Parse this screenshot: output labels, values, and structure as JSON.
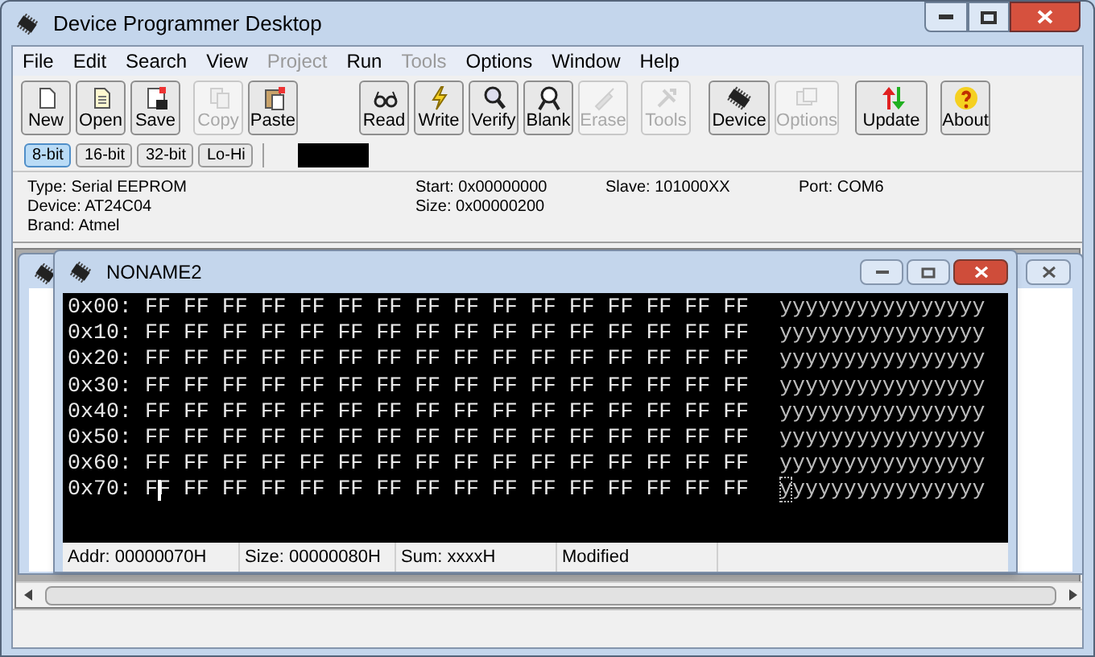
{
  "window": {
    "title": "Device Programmer Desktop"
  },
  "menu": [
    {
      "label": "File",
      "disabled": false
    },
    {
      "label": "Edit",
      "disabled": false
    },
    {
      "label": "Search",
      "disabled": false
    },
    {
      "label": "View",
      "disabled": false
    },
    {
      "label": "Project",
      "disabled": true
    },
    {
      "label": "Run",
      "disabled": false
    },
    {
      "label": "Tools",
      "disabled": true
    },
    {
      "label": "Options",
      "disabled": false
    },
    {
      "label": "Window",
      "disabled": false
    },
    {
      "label": "Help",
      "disabled": false
    }
  ],
  "toolbar_groups": [
    [
      {
        "label": "New",
        "kind": "new",
        "disabled": false
      },
      {
        "label": "Open",
        "kind": "open",
        "disabled": false
      },
      {
        "label": "Save",
        "kind": "save",
        "disabled": false
      }
    ],
    [
      {
        "label": "Copy",
        "kind": "copy",
        "disabled": true
      },
      {
        "label": "Paste",
        "kind": "paste",
        "disabled": false
      }
    ],
    [
      {
        "label": "Read",
        "kind": "read",
        "disabled": false
      },
      {
        "label": "Write",
        "kind": "write",
        "disabled": false
      },
      {
        "label": "Verify",
        "kind": "verify",
        "disabled": false
      },
      {
        "label": "Blank",
        "kind": "blank",
        "disabled": false
      },
      {
        "label": "Erase",
        "kind": "erase",
        "disabled": true
      }
    ],
    [
      {
        "label": "Tools",
        "kind": "tools",
        "disabled": true
      }
    ],
    [
      {
        "label": "Device",
        "kind": "device",
        "disabled": false
      },
      {
        "label": "Options",
        "kind": "options",
        "disabled": true
      }
    ],
    [
      {
        "label": "Update",
        "kind": "update",
        "disabled": false
      }
    ],
    [
      {
        "label": "About",
        "kind": "about",
        "disabled": false
      }
    ]
  ],
  "width_tabs": [
    {
      "label": "8-bit",
      "selected": true
    },
    {
      "label": "16-bit",
      "selected": false
    },
    {
      "label": "32-bit",
      "selected": false
    },
    {
      "label": "Lo-Hi",
      "selected": false
    }
  ],
  "info_columns": [
    [
      "Type: Serial EEPROM",
      "Device: AT24C04",
      "Brand: Atmel"
    ],
    [
      "Start: 0x00000000",
      "Size: 0x00000200"
    ],
    [
      "Slave: 101000XX"
    ],
    [
      "Port: COM6"
    ]
  ],
  "editor": {
    "title": "NONAME2",
    "rows": [
      {
        "address": "0x00:",
        "hex": "FF FF FF FF FF FF FF FF FF FF FF FF FF FF FF FF",
        "ascii": "yyyyyyyyyyyyyyyy",
        "cursor": false
      },
      {
        "address": "0x10:",
        "hex": "FF FF FF FF FF FF FF FF FF FF FF FF FF FF FF FF",
        "ascii": "yyyyyyyyyyyyyyyy",
        "cursor": false
      },
      {
        "address": "0x20:",
        "hex": "FF FF FF FF FF FF FF FF FF FF FF FF FF FF FF FF",
        "ascii": "yyyyyyyyyyyyyyyy",
        "cursor": false
      },
      {
        "address": "0x30:",
        "hex": "FF FF FF FF FF FF FF FF FF FF FF FF FF FF FF FF",
        "ascii": "yyyyyyyyyyyyyyyy",
        "cursor": false
      },
      {
        "address": "0x40:",
        "hex": "FF FF FF FF FF FF FF FF FF FF FF FF FF FF FF FF",
        "ascii": "yyyyyyyyyyyyyyyy",
        "cursor": false
      },
      {
        "address": "0x50:",
        "hex": "FF FF FF FF FF FF FF FF FF FF FF FF FF FF FF FF",
        "ascii": "yyyyyyyyyyyyyyyy",
        "cursor": false
      },
      {
        "address": "0x60:",
        "hex": "FF FF FF FF FF FF FF FF FF FF FF FF FF FF FF FF",
        "ascii": "yyyyyyyyyyyyyyyy",
        "cursor": false
      },
      {
        "address": "0x70:",
        "hex": "FF FF FF FF FF FF FF FF FF FF FF FF FF FF FF FF",
        "ascii": "yyyyyyyyyyyyyyyy",
        "cursor": true
      }
    ],
    "status": [
      "Addr: 00000070H",
      "Size: 00000080H",
      "Sum: xxxxH",
      "Modified"
    ]
  }
}
